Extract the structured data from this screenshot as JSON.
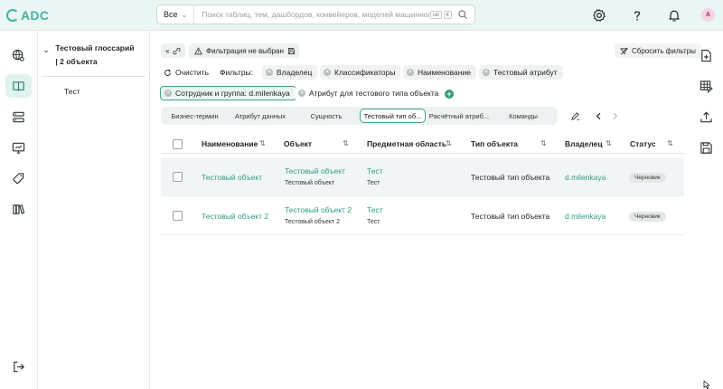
{
  "app": {
    "logo_text": "ADC",
    "brand_color": "#46b29f"
  },
  "search": {
    "scope": "Все",
    "placeholder": "Поиск таблиц, тем, дашбордов, конвейеров, моделей машинного о...",
    "kbd": [
      "ctrl",
      "K"
    ]
  },
  "topbar_icons": [
    "gear-icon",
    "help-icon",
    "bell-icon"
  ],
  "user": {
    "avatar_letter": "A"
  },
  "glossary": {
    "title_line1": "Тестовый глоссарий",
    "title_line2": "| 2 объекта",
    "leaf": "Тест"
  },
  "toolbar": {
    "collapse": "«",
    "filter_status": "Фильтрация не выбрана",
    "reset_filters": "Сбросить фильтры"
  },
  "filters": {
    "clear_label": "Очистить",
    "filters_label": "Фильтры:",
    "tags": [
      "Владелец",
      "Классификаторы",
      "Наименование",
      "Тестовый атрибут",
      "Сотрудник и группа: d.milenkaya",
      "Атрибут для тестового типа объекта"
    ],
    "selected_tag": "Сотрудник и группа: d.milenkaya"
  },
  "tabs": [
    "Бизнес-термин",
    "Атрибут данных",
    "Сущность",
    "Тестовый тип об...",
    "Расчётный атриб...",
    "Команды"
  ],
  "active_tab": "Тестовый тип об...",
  "table": {
    "columns": [
      "Наименование",
      "Объект",
      "Предметная область",
      "Тип объекта",
      "Владелец",
      "Статус"
    ],
    "rows": [
      {
        "name": "Тестовый объект",
        "object": "Тестовый объект",
        "object_sub": "Тестовый объект",
        "domain": "Тест",
        "domain_sub": "Тест",
        "type": "Тестовый тип объекта",
        "owner": "d.milenkaya",
        "status": "Черновик"
      },
      {
        "name": "Тестовый объект 2",
        "object": "Тестовый объект 2",
        "object_sub": "Тестовый объект 2",
        "domain": "Тест",
        "domain_sub": "Тест",
        "type": "Тестовый тип объекта",
        "owner": "d.milenkaya",
        "status": "Черновик"
      }
    ]
  },
  "accent_color": "#3e9f8d"
}
